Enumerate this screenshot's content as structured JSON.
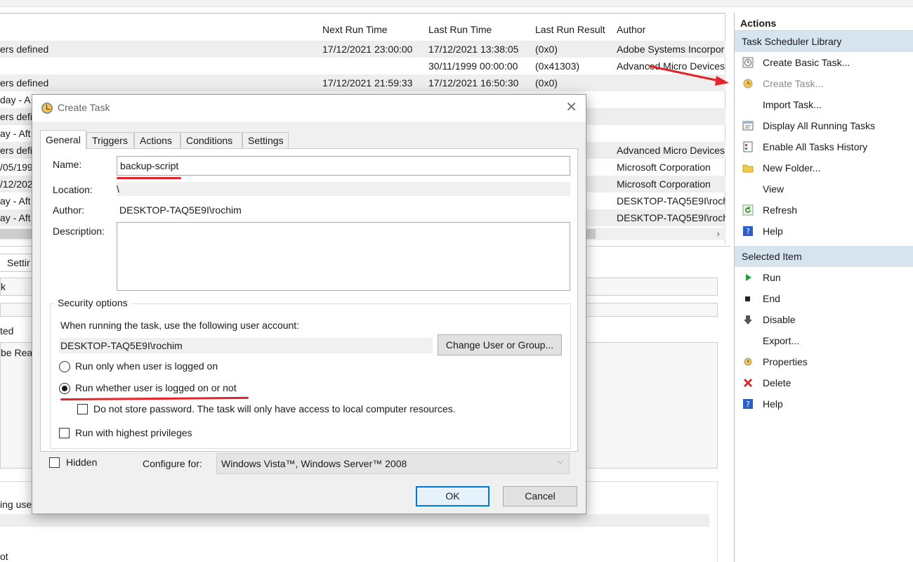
{
  "task_list": {
    "columns": [
      "Next Run Time",
      "Last Run Time",
      "Last Run Result",
      "Author"
    ],
    "rows": [
      {
        "trigger": "ers defined",
        "next": "17/12/2021 23:00:00",
        "last": "17/12/2021 13:38:05",
        "result": "(0x0)",
        "author": "Adobe Systems Incorpor"
      },
      {
        "trigger": "",
        "next": "",
        "last": "30/11/1999 00:00:00",
        "result": "(0x41303)",
        "author": "Advanced Micro Devices"
      },
      {
        "trigger": "ers defined",
        "next": "17/12/2021 21:59:33",
        "last": "17/12/2021 16:50:30",
        "result": "(0x0)",
        "author": ""
      },
      {
        "trigger": "day - A",
        "next": "",
        "last": "",
        "result": "",
        "author": ""
      },
      {
        "trigger": "ers defi",
        "next": "",
        "last": "",
        "result": "",
        "author": ""
      },
      {
        "trigger": "ay - Aft",
        "next": "",
        "last": "",
        "result": "",
        "author": ""
      },
      {
        "trigger": "ers defi",
        "next": "",
        "last": "",
        "result": "",
        "author": "Advanced Micro Devices"
      },
      {
        "trigger": "/05/199",
        "next": "",
        "last": "",
        "result": "4)",
        "author": "Microsoft Corporation"
      },
      {
        "trigger": "/12/202",
        "next": "",
        "last": "",
        "result": "",
        "author": "Microsoft Corporation"
      },
      {
        "trigger": "ay - Aft",
        "next": "",
        "last": "",
        "result": "",
        "author": "DESKTOP-TAQ5E9I\\rochi"
      },
      {
        "trigger": "ay - Aft",
        "next": "",
        "last": "",
        "result": "",
        "author": "DESKTOP-TAQ5E9I\\rochi"
      }
    ],
    "scroll_arrow": "›"
  },
  "lower_pane": {
    "tab": "Settir",
    "name_fragment": "k",
    "status_fragment": "ted",
    "desc_fragment": "be Read",
    "user_fragment": "ing user",
    "last_fragment": "ot"
  },
  "actions_pane": {
    "header": "Actions",
    "library_section": "Task Scheduler Library",
    "library_items": [
      {
        "label": "Create Basic Task...",
        "icon": "basic-task-icon",
        "dim": false
      },
      {
        "label": "Create Task...",
        "icon": "create-task-icon",
        "dim": true
      },
      {
        "label": "Import Task...",
        "icon": "",
        "dim": false
      },
      {
        "label": "Display All Running Tasks",
        "icon": "running-tasks-icon",
        "dim": false
      },
      {
        "label": "Enable All Tasks History",
        "icon": "history-icon",
        "dim": false
      },
      {
        "label": "New Folder...",
        "icon": "folder-icon",
        "dim": false
      },
      {
        "label": "View",
        "icon": "",
        "dim": false
      },
      {
        "label": "Refresh",
        "icon": "refresh-icon",
        "dim": false
      },
      {
        "label": "Help",
        "icon": "help-icon",
        "dim": false
      }
    ],
    "selected_section": "Selected Item",
    "selected_items": [
      {
        "label": "Run",
        "icon": "run-icon"
      },
      {
        "label": "End",
        "icon": "end-icon"
      },
      {
        "label": "Disable",
        "icon": "disable-icon"
      },
      {
        "label": "Export...",
        "icon": ""
      },
      {
        "label": "Properties",
        "icon": "properties-icon"
      },
      {
        "label": "Delete",
        "icon": "delete-icon"
      },
      {
        "label": "Help",
        "icon": "help-icon"
      }
    ]
  },
  "dialog": {
    "title": "Create Task",
    "close_glyph": "✕",
    "tabs": [
      "General",
      "Triggers",
      "Actions",
      "Conditions",
      "Settings"
    ],
    "name_label": "Name:",
    "name_value": "backup-script",
    "location_label": "Location:",
    "location_value": "\\",
    "author_label": "Author:",
    "author_value": "DESKTOP-TAQ5E9I\\rochim",
    "description_label": "Description:",
    "security": {
      "legend": "Security options",
      "account_prompt": "When running the task, use the following user account:",
      "account_value": "DESKTOP-TAQ5E9I\\rochim",
      "change_button": "Change User or Group...",
      "radio_logged_on": "Run only when user is logged on",
      "radio_whether": "Run whether user is logged on or not",
      "selected_radio": "whether",
      "no_store_password": "Do not store password.  The task will only have access to local computer resources.",
      "highest_privileges": "Run with highest privileges"
    },
    "hidden_label": "Hidden",
    "configure_label": "Configure for:",
    "configure_value": "Windows Vista™, Windows Server™ 2008",
    "ok": "OK",
    "cancel": "Cancel"
  },
  "colors": {
    "annotation_red": "#e3242b",
    "section_blue": "#d6e4f0",
    "default_button_border": "#0078d7"
  }
}
